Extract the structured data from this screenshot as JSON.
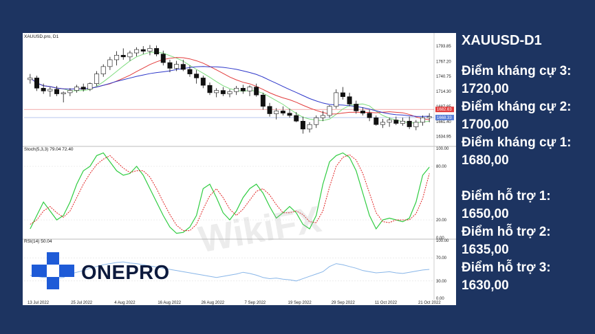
{
  "info": {
    "title": "XAUUSD-D1",
    "levels": [
      {
        "label": "Điểm kháng cự 3:",
        "value": "1720,00"
      },
      {
        "label": "Điểm kháng cự 2:",
        "value": "1700,00"
      },
      {
        "label": "Điểm kháng cự 1:",
        "value": "1680,00"
      },
      {
        "label": "Điểm hỗ trợ 1:",
        "value": "1650,00"
      },
      {
        "label": "Điểm hỗ trợ 2:",
        "value": "1635,00"
      },
      {
        "label": "Điểm hỗ trợ 3:",
        "value": "1630,00"
      }
    ]
  },
  "logo": {
    "text": "ONEPRO",
    "colors": [
      "#1e5bd7",
      "#0d1a3d"
    ]
  },
  "watermark": {
    "text": "WikiFX"
  },
  "chart_data": {
    "type": "candlestick",
    "symbol_label": "XAUUSD.pro, D1",
    "price_axis": {
      "ylim": [
        1620,
        1805
      ],
      "ticks": [
        "1793.85",
        "1767.20",
        "1740.75",
        "1714.30",
        "1687.85",
        "1661.40",
        "1634.95"
      ]
    },
    "price_markers": [
      {
        "label": "1682.63",
        "value": 1682.63,
        "color": "#e23b3b"
      },
      {
        "label": "1668.33",
        "value": 1668.33,
        "color": "#5a7fd8"
      }
    ],
    "x_ticks": [
      "13 Jul 2022",
      "25 Jul 2022",
      "4 Aug 2022",
      "16 Aug 2022",
      "26 Aug 2022",
      "7 Sep 2022",
      "19 Sep 2022",
      "29 Sep 2022",
      "11 Oct 2022",
      "21 Oct 2022"
    ],
    "candles": [
      [
        1735,
        1745,
        1728,
        1738
      ],
      [
        1738,
        1742,
        1715,
        1720
      ],
      [
        1720,
        1728,
        1710,
        1715
      ],
      [
        1715,
        1722,
        1705,
        1718
      ],
      [
        1718,
        1724,
        1706,
        1710
      ],
      [
        1710,
        1714,
        1695,
        1712
      ],
      [
        1712,
        1720,
        1706,
        1716
      ],
      [
        1716,
        1726,
        1712,
        1722
      ],
      [
        1722,
        1728,
        1714,
        1718
      ],
      [
        1718,
        1730,
        1715,
        1728
      ],
      [
        1728,
        1750,
        1724,
        1745
      ],
      [
        1745,
        1762,
        1740,
        1758
      ],
      [
        1758,
        1775,
        1752,
        1770
      ],
      [
        1770,
        1785,
        1760,
        1778
      ],
      [
        1778,
        1790,
        1770,
        1775
      ],
      [
        1775,
        1786,
        1768,
        1782
      ],
      [
        1782,
        1792,
        1776,
        1788
      ],
      [
        1788,
        1794,
        1780,
        1785
      ],
      [
        1785,
        1796,
        1778,
        1790
      ],
      [
        1790,
        1795,
        1776,
        1780
      ],
      [
        1780,
        1786,
        1760,
        1765
      ],
      [
        1765,
        1770,
        1748,
        1755
      ],
      [
        1755,
        1768,
        1750,
        1762
      ],
      [
        1762,
        1770,
        1750,
        1753
      ],
      [
        1753,
        1760,
        1740,
        1745
      ],
      [
        1745,
        1752,
        1728,
        1738
      ],
      [
        1738,
        1742,
        1720,
        1725
      ],
      [
        1725,
        1730,
        1708,
        1712
      ],
      [
        1712,
        1720,
        1704,
        1716
      ],
      [
        1716,
        1722,
        1706,
        1710
      ],
      [
        1710,
        1718,
        1704,
        1714
      ],
      [
        1714,
        1724,
        1708,
        1720
      ],
      [
        1720,
        1726,
        1710,
        1715
      ],
      [
        1715,
        1725,
        1706,
        1722
      ],
      [
        1722,
        1728,
        1705,
        1708
      ],
      [
        1708,
        1712,
        1682,
        1688
      ],
      [
        1688,
        1694,
        1670,
        1675
      ],
      [
        1675,
        1685,
        1665,
        1680
      ],
      [
        1680,
        1688,
        1672,
        1676
      ],
      [
        1676,
        1684,
        1668,
        1672
      ],
      [
        1672,
        1678,
        1660,
        1662
      ],
      [
        1662,
        1670,
        1640,
        1648
      ],
      [
        1648,
        1660,
        1642,
        1656
      ],
      [
        1656,
        1672,
        1650,
        1668
      ],
      [
        1668,
        1680,
        1662,
        1672
      ],
      [
        1672,
        1690,
        1668,
        1688
      ],
      [
        1688,
        1718,
        1684,
        1712
      ],
      [
        1712,
        1722,
        1700,
        1705
      ],
      [
        1705,
        1712,
        1688,
        1692
      ],
      [
        1692,
        1698,
        1675,
        1680
      ],
      [
        1680,
        1686,
        1672,
        1676
      ],
      [
        1676,
        1682,
        1662,
        1668
      ],
      [
        1668,
        1672,
        1654,
        1656
      ],
      [
        1656,
        1666,
        1650,
        1660
      ],
      [
        1660,
        1668,
        1652,
        1664
      ],
      [
        1664,
        1670,
        1655,
        1658
      ],
      [
        1658,
        1668,
        1654,
        1662
      ],
      [
        1662,
        1670,
        1648,
        1652
      ],
      [
        1652,
        1664,
        1646,
        1660
      ],
      [
        1660,
        1672,
        1654,
        1668
      ],
      [
        1668,
        1676,
        1660,
        1670
      ]
    ],
    "stochastic": {
      "label": "Stoch(5,3,3) 79.04 72.40",
      "ylim": [
        0,
        100
      ],
      "ticks": [
        "100.00",
        "80.00",
        "20.00",
        "0.00"
      ],
      "k_color": "#2ecc40",
      "d_color": "#e02020",
      "k": [
        10,
        25,
        40,
        30,
        20,
        25,
        40,
        60,
        75,
        80,
        92,
        95,
        85,
        75,
        70,
        72,
        80,
        70,
        55,
        40,
        25,
        12,
        5,
        6,
        12,
        25,
        55,
        60,
        45,
        28,
        20,
        30,
        45,
        55,
        60,
        50,
        35,
        22,
        28,
        35,
        28,
        15,
        10,
        25,
        60,
        85,
        92,
        95,
        90,
        75,
        50,
        25,
        10,
        20,
        22,
        20,
        18,
        22,
        40,
        70,
        79
      ],
      "d": [
        15,
        20,
        30,
        35,
        28,
        23,
        30,
        45,
        60,
        72,
        82,
        88,
        92,
        85,
        78,
        73,
        75,
        75,
        68,
        55,
        40,
        26,
        14,
        8,
        8,
        15,
        32,
        47,
        55,
        45,
        32,
        25,
        32,
        42,
        52,
        55,
        48,
        37,
        28,
        28,
        30,
        26,
        18,
        17,
        30,
        57,
        80,
        90,
        93,
        87,
        72,
        50,
        28,
        18,
        17,
        20,
        20,
        20,
        27,
        44,
        72
      ]
    },
    "rsi": {
      "label": "RSI(14) 50.04",
      "ylim": [
        0,
        100
      ],
      "ticks": [
        "100.00",
        "70.00",
        "30.00",
        "0.00"
      ],
      "color": "#87b5e8",
      "values": [
        40,
        38,
        36,
        37,
        35,
        36,
        42,
        45,
        48,
        52,
        55,
        58,
        60,
        62,
        63,
        61,
        60,
        58,
        56,
        54,
        52,
        50,
        48,
        46,
        44,
        42,
        40,
        38,
        36,
        38,
        40,
        42,
        45,
        43,
        40,
        36,
        34,
        35,
        33,
        32,
        30,
        34,
        38,
        42,
        46,
        55,
        60,
        58,
        55,
        52,
        48,
        46,
        44,
        45,
        46,
        44,
        43,
        45,
        47,
        49,
        50
      ]
    }
  }
}
